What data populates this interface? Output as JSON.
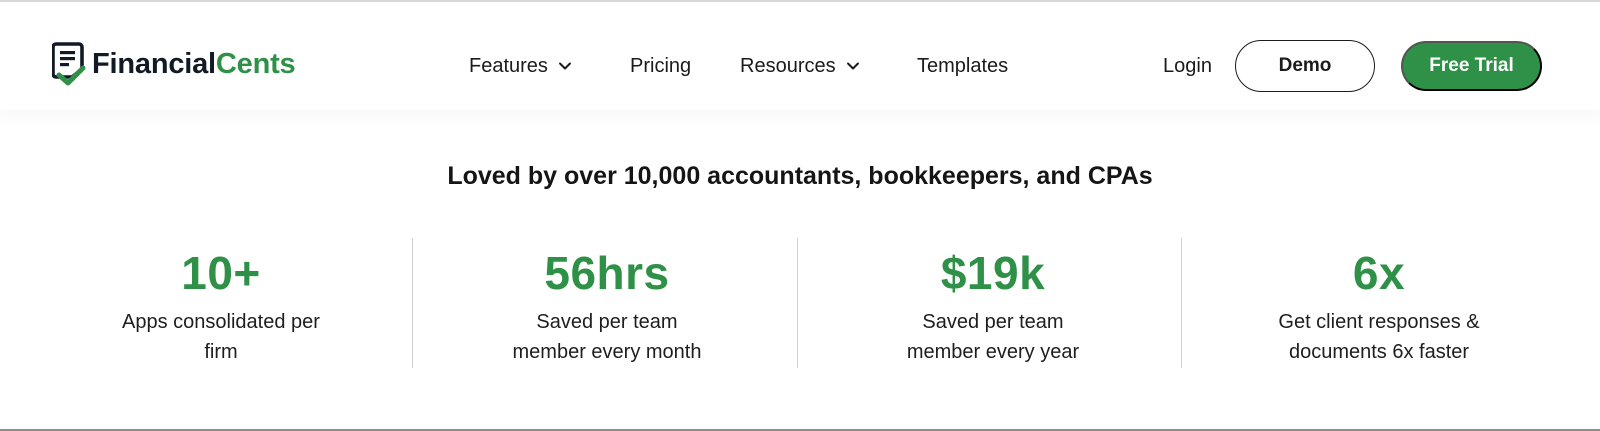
{
  "brand": {
    "name_part1": "Financial",
    "name_part2": "Cents",
    "colors": {
      "dark": "#121a26",
      "green": "#2e9147"
    },
    "logo_icon": "document-check-shield-icon"
  },
  "nav": {
    "items": [
      {
        "label": "Features",
        "has_dropdown": true
      },
      {
        "label": "Pricing",
        "has_dropdown": false
      },
      {
        "label": "Resources",
        "has_dropdown": true
      },
      {
        "label": "Templates",
        "has_dropdown": false
      }
    ],
    "login_label": "Login",
    "demo_label": "Demo",
    "trial_label": "Free Trial"
  },
  "stats_section": {
    "headline": "Loved by over 10,000 accountants, bookkeepers, and CPAs",
    "stats": [
      {
        "value": "10+",
        "desc_line1": "Apps consolidated per",
        "desc_line2": "firm"
      },
      {
        "value": "56hrs",
        "desc_line1": "Saved per team",
        "desc_line2": "member every month"
      },
      {
        "value": "$19k",
        "desc_line1": "Saved per team",
        "desc_line2": "member every year"
      },
      {
        "value": "6x",
        "desc_line1": "Get client responses &",
        "desc_line2": "documents 6x faster"
      }
    ]
  }
}
